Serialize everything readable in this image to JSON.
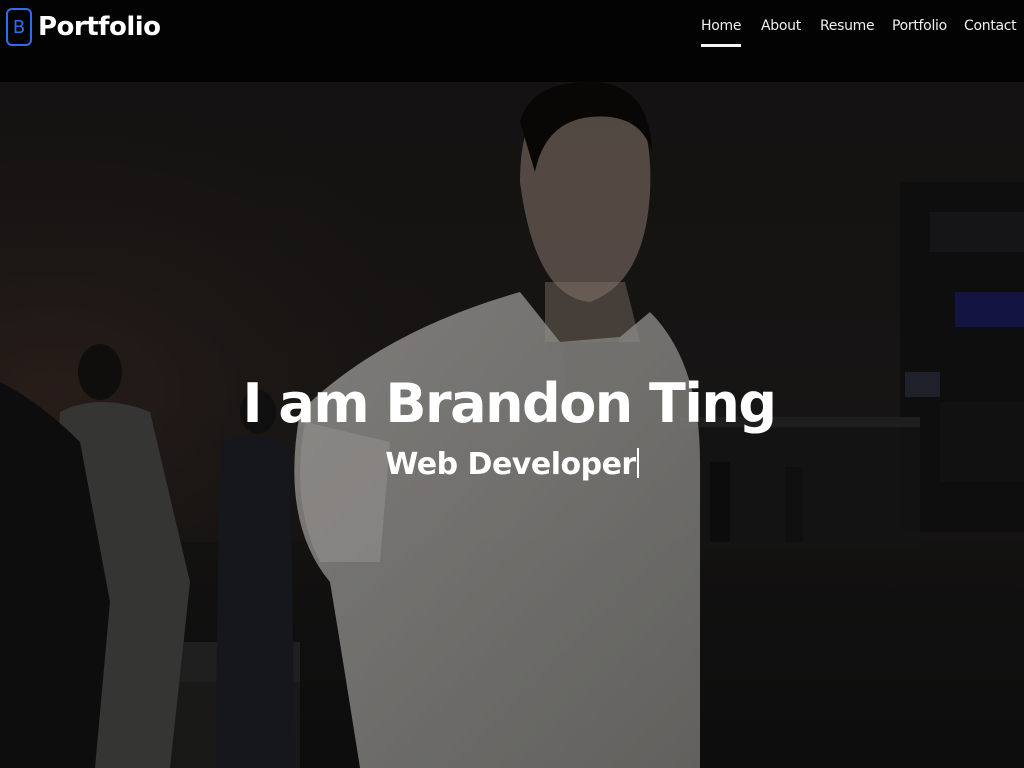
{
  "header": {
    "brand_letter": "B",
    "brand_name": "Portfolio",
    "nav_items": [
      {
        "label": "Home",
        "active": true
      },
      {
        "label": "About",
        "active": false
      },
      {
        "label": "Resume",
        "active": false
      },
      {
        "label": "Portfolio",
        "active": false
      },
      {
        "label": "Contact",
        "active": false
      }
    ]
  },
  "hero": {
    "title": "I am Brandon Ting",
    "subtitle": "Web Developer"
  },
  "colors": {
    "header_bg": "#030303",
    "brand_accent": "#2f6df0",
    "text": "#ffffff"
  }
}
